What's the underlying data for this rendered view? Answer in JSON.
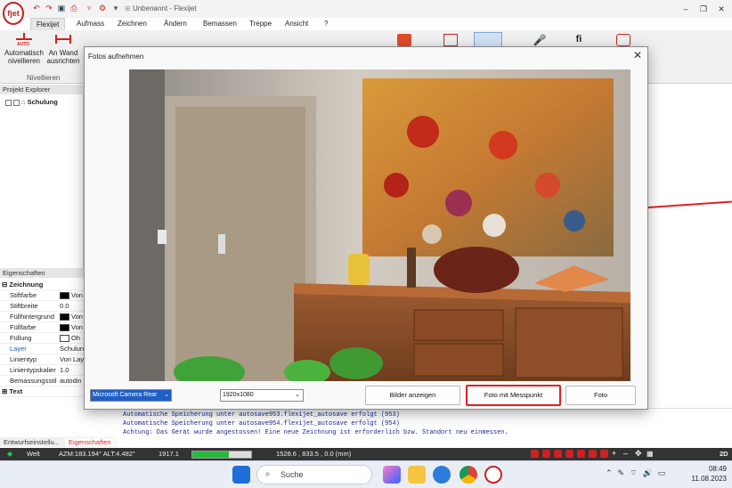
{
  "window": {
    "title": "Unbenannt - Flexijet",
    "logo_text": "fjet"
  },
  "menu": {
    "items": [
      "Flexijet",
      "Aufmass",
      "Zeichnen",
      "Ändern",
      "Bemassen",
      "Treppe",
      "Ansicht",
      "?"
    ],
    "active": "Flexijet"
  },
  "ribbon": {
    "btn1_line1": "Automatisch",
    "btn1_line2": "nivellieren",
    "btn1_badge": "AUTO",
    "btn2_line1": "An Wand",
    "btn2_line2": "ausrichten",
    "group_label": "Nivellieren"
  },
  "project_explorer": {
    "header": "Projekt Explorer",
    "root": "Schulung"
  },
  "properties": {
    "header": "Eigenschaften",
    "section": "Zeichnung",
    "rows": [
      {
        "key": "Stiftfarbe",
        "value": "Von",
        "swatch": "#000000"
      },
      {
        "key": "Stiftbreite",
        "value": "0.0"
      },
      {
        "key": "Füllhintergrund",
        "value": "Von",
        "swatch": "#000000"
      },
      {
        "key": "Füllfarbe",
        "value": "Von",
        "swatch": "#000000"
      },
      {
        "key": "Füllung",
        "value": "Oh",
        "swatch": "#ffffff"
      },
      {
        "key": "Layer",
        "value": "Schulun"
      },
      {
        "key": "Linientyp",
        "value": "Von Lay"
      },
      {
        "key": "Linientypskalier",
        "value": "1.0"
      },
      {
        "key": "Bemassungsstil",
        "value": "autodin"
      }
    ],
    "section2": "Text"
  },
  "bottom_tabs": [
    "Entwurfseinstellu...",
    "Eigenschaften"
  ],
  "log": {
    "lines": [
      "Automatische Speicherung unter autosave953.flexijet_autosave erfolgt (953)",
      "Automatische Speicherung unter autosave954.flexijet_autosave erfolgt (954)",
      "Achtung: Das Gerät wurde angestossen! Eine neue Zeichnung ist erforderlich bzw. Standort neu einmessen."
    ]
  },
  "status": {
    "mode": "Welt",
    "angles": "AZM:183.194° ALT:4.482°",
    "distance": "1917.1",
    "progress": 0.62,
    "coords": "1528.6 , 833.5 , 0.0 (mm)",
    "view": "2D"
  },
  "dialog": {
    "title": "Fotos aufnehmen",
    "camera": "Microsoft Camera Rear",
    "resolution": "1920x1080",
    "btn_show": "Bilder anzeigen",
    "btn_measure": "Foto mit Messpunkt",
    "btn_photo": "Foto"
  },
  "taskbar": {
    "search_placeholder": "Suche",
    "time": "08:49",
    "date": "11.08.2023"
  },
  "colors": {
    "accent_red": "#e02020",
    "progress_green": "#27b83c",
    "log_blue": "#1a2a9a"
  }
}
